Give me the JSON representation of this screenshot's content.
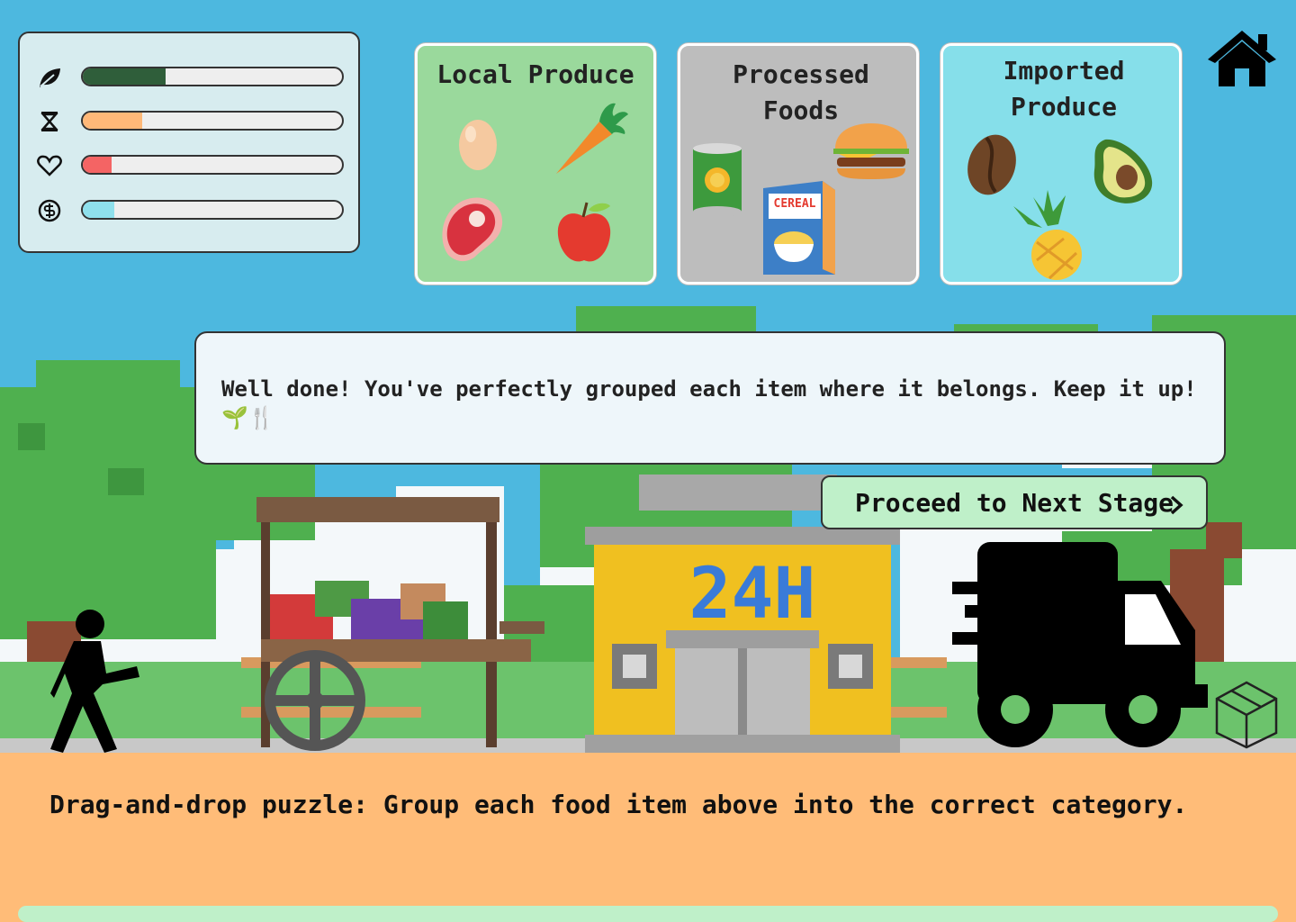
{
  "stats": [
    {
      "name": "sustainability",
      "icon": "leaf-icon",
      "level": 0.32,
      "color": "#2f5e3a"
    },
    {
      "name": "time",
      "icon": "hourglass-icon",
      "level": 0.23,
      "color": "#ffb878"
    },
    {
      "name": "health",
      "icon": "heart-icon",
      "level": 0.11,
      "color": "#f46464"
    },
    {
      "name": "money",
      "icon": "coin-icon",
      "level": 0.12,
      "color": "#8fe0ec"
    }
  ],
  "categories": {
    "local": {
      "title": "Local Produce",
      "color": "#9ad99c",
      "items": [
        "egg-icon",
        "carrot-icon",
        "meat-icon",
        "apple-icon"
      ]
    },
    "processed": {
      "title": "Processed Foods",
      "color": "#bdbdbd",
      "items": [
        "canned-food-icon",
        "burger-icon",
        "cereal-box-icon"
      ]
    },
    "imported": {
      "title": "Imported Produce",
      "color": "#86dfea",
      "items": [
        "coffee-bean-icon",
        "avocado-icon",
        "pineapple-icon"
      ]
    }
  },
  "cereal_label": "CEREAL",
  "store_sign": "24H",
  "message": "Well done! You've perfectly grouped each item where it belongs. Keep it up!\n🌱🍴",
  "next_button": {
    "label": "Proceed to Next Stage",
    "icon": "chevron-right-icon"
  },
  "instructions": "Drag-and-drop puzzle: Group each food item above into the correct category.",
  "colors": {
    "sky": "#4db8df",
    "ground": "#ffbc78",
    "button": "#bff0c9",
    "store": "#f0c020",
    "tree": "#4fb04f"
  }
}
